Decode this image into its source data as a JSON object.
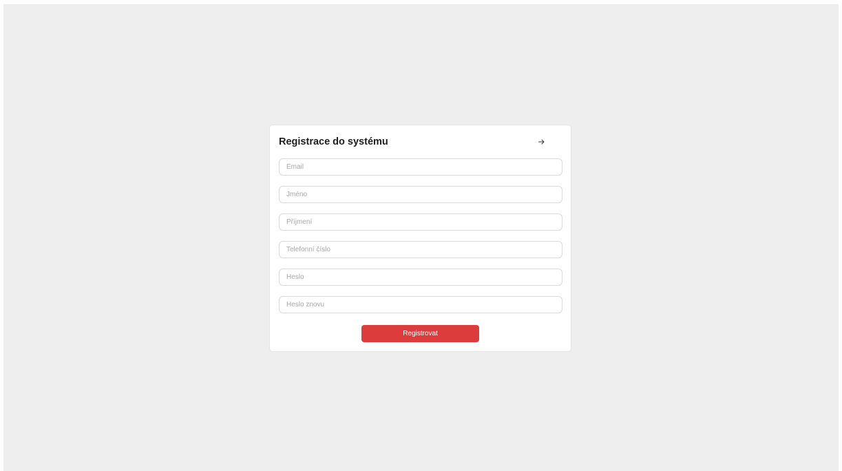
{
  "colors": {
    "page_background": "#eeeeee",
    "card_background": "#ffffff",
    "accent": "#dc3c3c"
  },
  "form": {
    "title": "Registrace do systému",
    "nav_icon": "arrow-right-icon",
    "fields": [
      {
        "placeholder": "Email"
      },
      {
        "placeholder": "Jméno"
      },
      {
        "placeholder": "Příjmení"
      },
      {
        "placeholder": "Telefonní číslo"
      },
      {
        "placeholder": "Heslo"
      },
      {
        "placeholder": "Heslo znovu"
      }
    ],
    "submit_label": "Registrovat"
  }
}
